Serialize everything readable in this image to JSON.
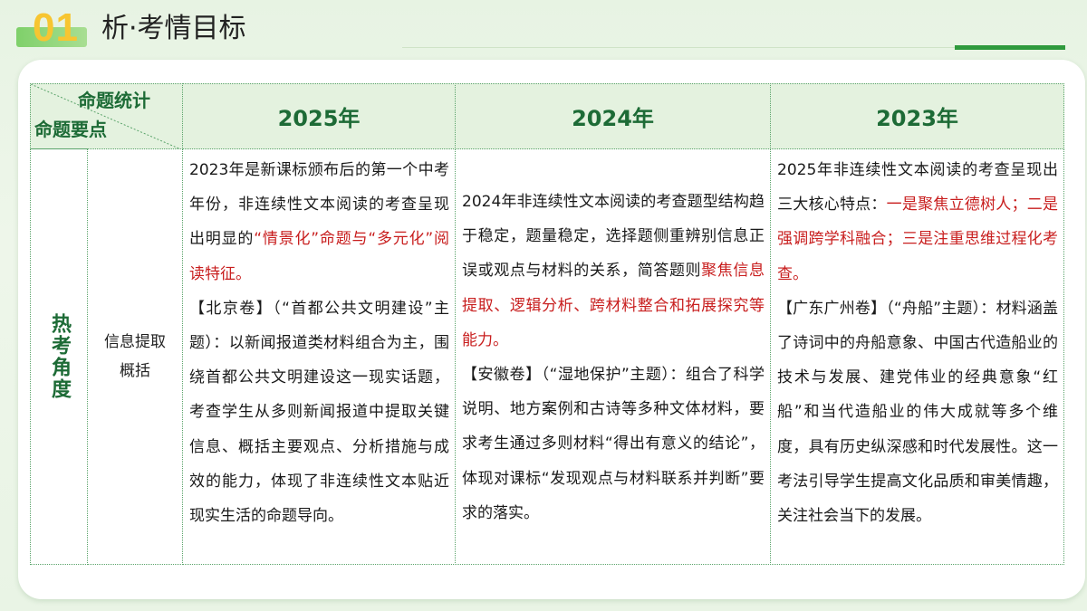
{
  "header": {
    "section_number": "01",
    "section_title": "析·考情目标"
  },
  "table": {
    "corner_top": "命题统计",
    "corner_bottom": "命题要点",
    "years": [
      "2025年",
      "2024年",
      "2023年"
    ],
    "side_label": "热考角度",
    "sub_label_line1": "信息提取",
    "sub_label_line2": "概括",
    "col2025": {
      "intro_a": "2023年是新课标颁布后的第一个中考年份，非连续性文本阅读的考查呈现出明显的",
      "intro_red": "“情景化”命题与“多元化”阅读特征。",
      "example": "【北京卷】（“首都公共文明建设”主题）：以新闻报道类材料组合为主，围绕首都公共文明建设这一现实话题，考查学生从多则新闻报道中提取关键信息、概括主要观点、分析措施与成效的能力，体现了非连续性文本贴近现实生活的命题导向。"
    },
    "col2024": {
      "intro_a": "2024年非连续性文本阅读的考查题型结构趋于稳定，题量稳定，选择题侧重辨别信息正误或观点与材料的关系，简答题则",
      "intro_red": "聚焦信息提取、逻辑分析、跨材料整合和拓展探究等能力。",
      "example": "【安徽卷】（“湿地保护”主题）：组合了科学说明、地方案例和古诗等多种文体材料，要求考生通过多则材料“得出有意义的结论”，体现对课标“发现观点与材料联系并判断”要求的落实。"
    },
    "col2023": {
      "intro_a": "2025年非连续性文本阅读的考查呈现出三大核心特点：",
      "intro_red": "一是聚焦立德树人；二是强调跨学科融合；三是注重思维过程化考查。",
      "example": "【广东广州卷】（“舟船”主题）：材料涵盖了诗词中的舟船意象、中国古代造船业的技术与发展、建党伟业的经典意象“红船”和当代造船业的伟大成就等多个维度，具有历史纵深感和时代发展性。这一考法引导学生提高文化品质和审美情趣，关注社会当下的发展。"
    }
  }
}
